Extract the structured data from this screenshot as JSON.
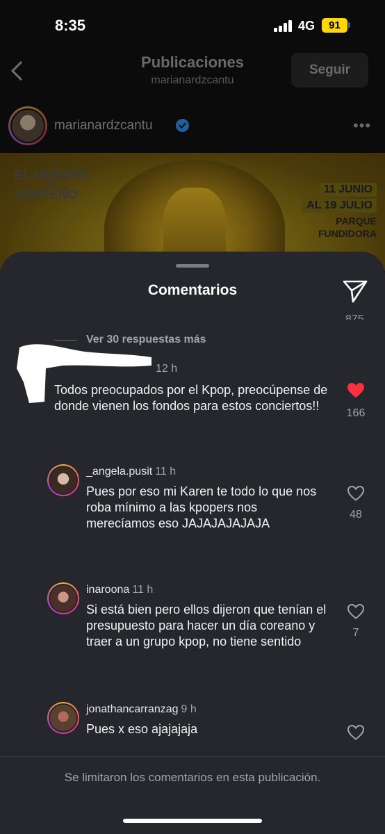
{
  "status_bar": {
    "time": "8:35",
    "network": "4G",
    "battery": "91"
  },
  "header": {
    "title": "Publicaciones",
    "subtitle": "marianardzcantu",
    "follow_label": "Seguir"
  },
  "post": {
    "username": "marianardzcantu",
    "poster": {
      "logo_line1": "EL MUNDIAL",
      "logo_small": "MÁS",
      "logo_line2": "NORTEÑO",
      "date1": "11 JUNIO",
      "date2": "AL 19 JULIO",
      "venue1": "PARQUE",
      "venue2": "FUNDIDORA"
    }
  },
  "comments_sheet": {
    "title": "Comentarios",
    "prev_like_count": "875",
    "more_replies": "Ver 30 respuestas más",
    "main_comment": {
      "time": "12 h",
      "text": "Todos preocupados por el Kpop, preocúpense de donde vienen los fondos para estos conciertos!!",
      "likes": "166",
      "liked": true
    },
    "replies": [
      {
        "username": "_angela.pusit",
        "time": "11 h",
        "text": "Pues por eso mi Karen te todo lo que nos roba mínimo a las kpopers nos merecíamos eso JAJAJAJAJAJA",
        "likes": "48"
      },
      {
        "username": "inaroona",
        "time": "11 h",
        "text": "Si está bien pero ellos dijeron que tenían el presupuesto para hacer un día coreano y traer a un grupo kpop, no tiene sentido",
        "likes": "7"
      },
      {
        "username": "jonathancarranzag",
        "time": "9 h",
        "text": "Pues x eso ajajajaja",
        "likes": ""
      }
    ],
    "limit_notice": "Se limitaron los comentarios en esta publicación."
  },
  "colors": {
    "like_red": "#ff3040",
    "sheet_bg": "#26272c",
    "battery_yellow": "#ffd60a"
  }
}
